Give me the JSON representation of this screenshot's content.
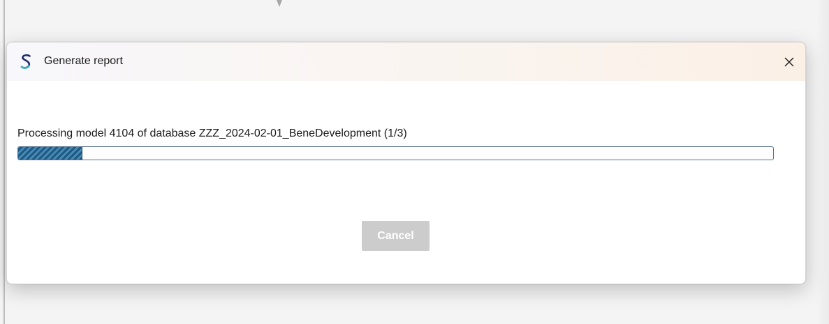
{
  "dialog": {
    "title": "Generate report",
    "app_icon": "app-s-logo-icon",
    "close_icon": "close-icon",
    "status_text": "Processing model 4104 of database ZZZ_2024-02-01_BeneDevelopment  (1/3)",
    "progress": {
      "value_fraction": 0.085,
      "style": "striped"
    },
    "cancel_label": "Cancel",
    "cancel_enabled": false
  },
  "colors": {
    "progress_fill": "#2e6d96",
    "progress_border": "#54708a",
    "cancel_disabled_bg": "#cccccc",
    "logo_dark": "#1f2a6b",
    "logo_accent": "#34b8c8"
  }
}
